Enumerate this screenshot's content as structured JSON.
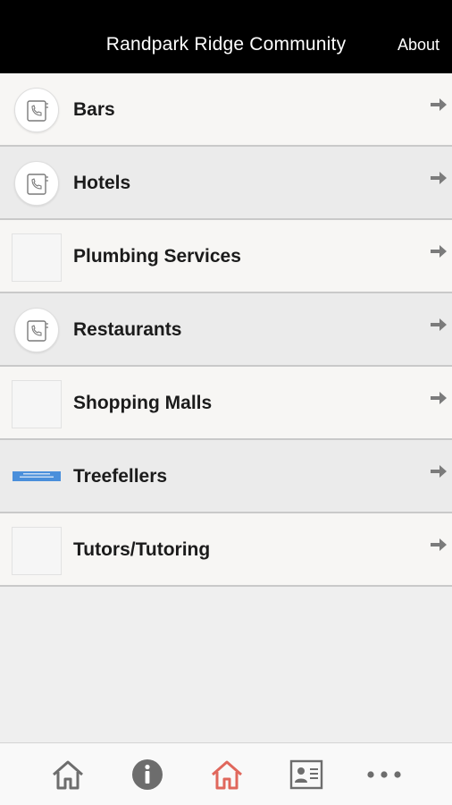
{
  "header": {
    "title": "Randpark Ridge Community",
    "about_label": "About"
  },
  "list": {
    "items": [
      {
        "label": "Bars",
        "thumb": "phone-book-icon",
        "shade": "light"
      },
      {
        "label": "Hotels",
        "thumb": "phone-book-icon",
        "shade": "dark"
      },
      {
        "label": "Plumbing Services",
        "thumb": "blank-thumbnail",
        "shade": "light"
      },
      {
        "label": "Restaurants",
        "thumb": "phone-book-icon",
        "shade": "dark"
      },
      {
        "label": "Shopping Malls",
        "thumb": "blank-thumbnail",
        "shade": "light"
      },
      {
        "label": "Treefellers",
        "thumb": "banner-thumbnail",
        "shade": "dark"
      },
      {
        "label": "Tutors/Tutoring",
        "thumb": "blank-thumbnail",
        "shade": "light"
      }
    ],
    "arrow_icon": "arrow-right-icon"
  },
  "tabbar": {
    "tabs": [
      {
        "icon": "home-icon",
        "active": false
      },
      {
        "icon": "info-icon",
        "active": false
      },
      {
        "icon": "home-icon",
        "active": true
      },
      {
        "icon": "contact-card-icon",
        "active": false
      },
      {
        "icon": "more-icon",
        "active": false
      }
    ],
    "active_color": "#e0675c",
    "inactive_color": "#6d6d6d"
  },
  "colors": {
    "header_bg": "#000000",
    "row_light": "#f7f6f4",
    "row_dark": "#ebebeb",
    "banner_blue": "#4a8fdb"
  }
}
